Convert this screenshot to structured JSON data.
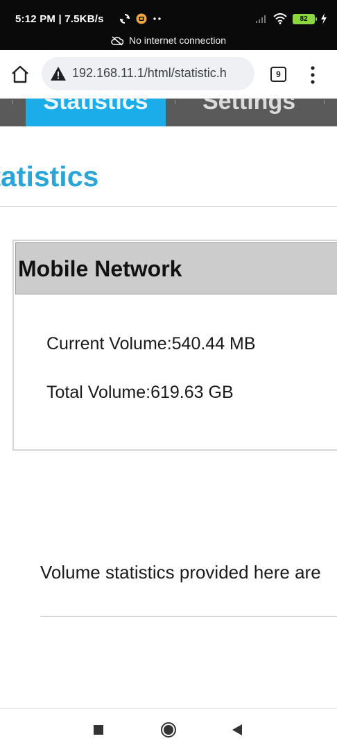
{
  "status_bar": {
    "time": "5:12 PM | 7.5KB/s",
    "battery_level": "82",
    "offline_message": "No internet connection",
    "icons": [
      "sync-icon",
      "notification-app-icon",
      "more-dots-icon",
      "signal-icon",
      "wifi-icon",
      "battery-icon",
      "charging-icon"
    ]
  },
  "browser": {
    "url": "192.168.11.1/html/statistic.h",
    "tab_count": "9",
    "icons": [
      "home-icon",
      "not-secure-warning-icon",
      "tab-switcher-icon",
      "overflow-menu-icon"
    ]
  },
  "nav": {
    "tabs": [
      {
        "label": "Statistics",
        "active": true
      },
      {
        "label": "Settings",
        "active": false
      }
    ]
  },
  "page": {
    "title": "Statistics",
    "panel": {
      "title": "Mobile Network",
      "current_volume": "Current Volume:540.44 MB",
      "total_volume": "Total Volume:619.63 GB"
    },
    "note": "Volume statistics provided here are"
  },
  "system_nav": {
    "icons": [
      "recents-square-icon",
      "home-circle-icon",
      "back-triangle-icon"
    ]
  },
  "colors": {
    "accent": "#2aa6d6",
    "active_tab": "#1aadea",
    "nav_background": "#5a5a5a",
    "panel_header": "#cccccc"
  }
}
